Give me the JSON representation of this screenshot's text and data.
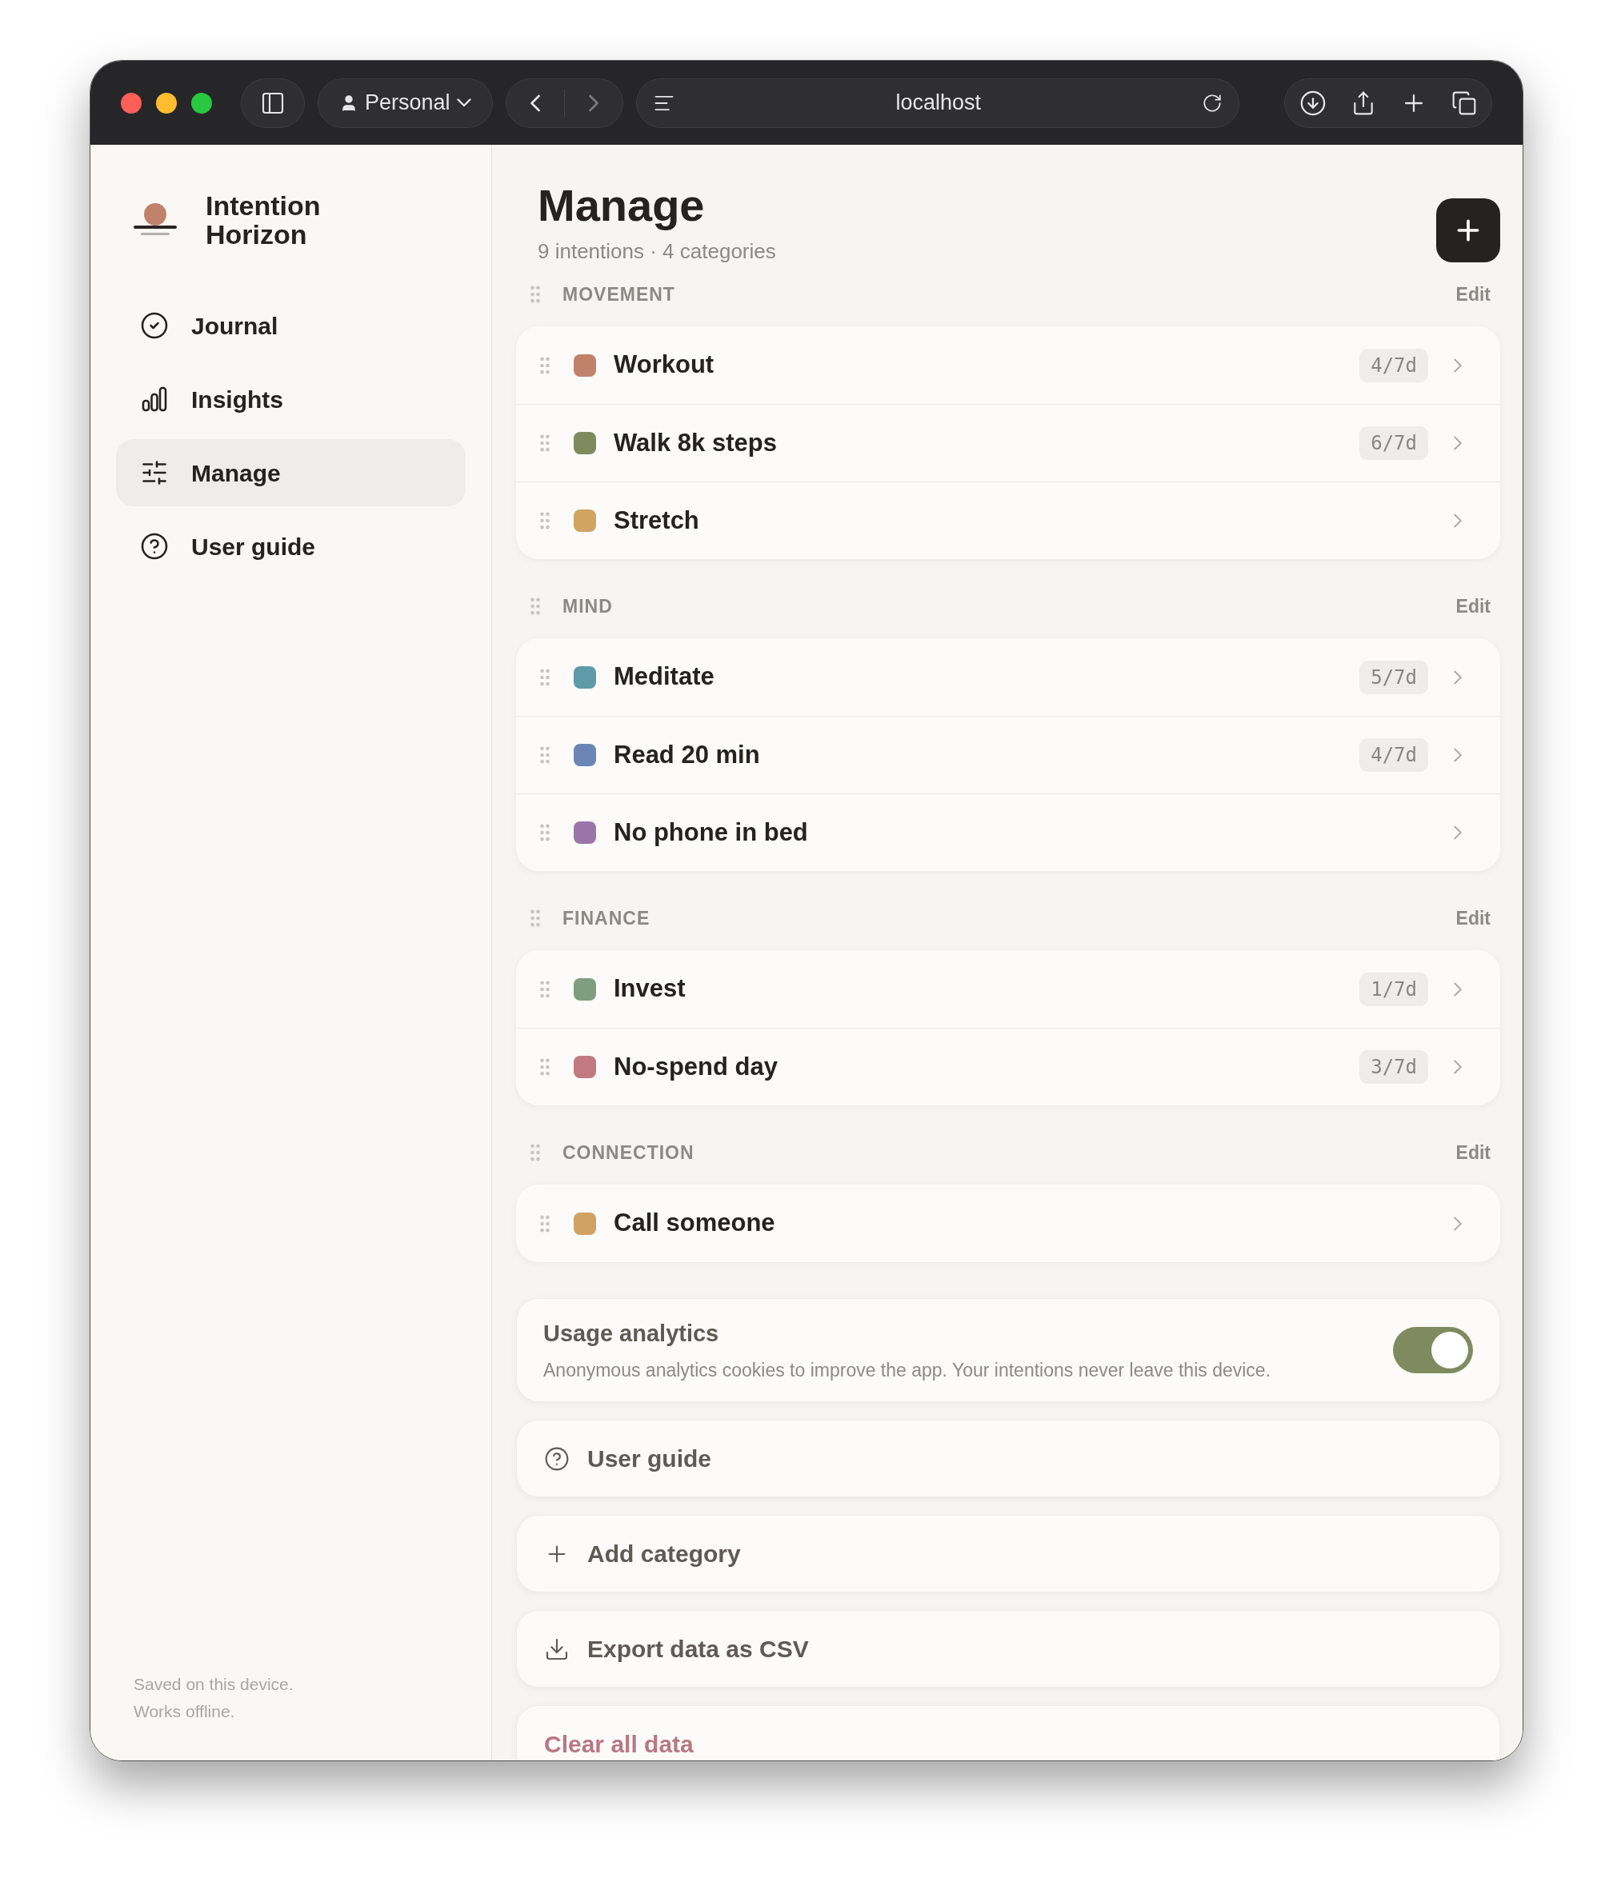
{
  "browser": {
    "profile": "Personal",
    "address": "localhost"
  },
  "sidebar": {
    "brand": [
      "Intention",
      "Horizon"
    ],
    "items": [
      {
        "label": "Journal",
        "selected": false
      },
      {
        "label": "Insights",
        "selected": false
      },
      {
        "label": "Manage",
        "selected": true
      },
      {
        "label": "User guide",
        "selected": false
      }
    ],
    "footer": [
      "Saved on this device.",
      "Works offline."
    ]
  },
  "header": {
    "title": "Manage",
    "subtitle": "9 intentions · 4 categories"
  },
  "categories": [
    {
      "name": "MOVEMENT",
      "edit": "Edit",
      "intentions": [
        {
          "name": "Workout",
          "color": "#c0826a",
          "badge": "4/7d"
        },
        {
          "name": "Walk 8k steps",
          "color": "#7f8b5f",
          "badge": "6/7d"
        },
        {
          "name": "Stretch",
          "color": "#d0a463"
        }
      ]
    },
    {
      "name": "MIND",
      "edit": "Edit",
      "intentions": [
        {
          "name": "Meditate",
          "color": "#5f9aa8",
          "badge": "5/7d"
        },
        {
          "name": "Read 20 min",
          "color": "#6b86b5",
          "badge": "4/7d"
        },
        {
          "name": "No phone in bed",
          "color": "#9a76a8"
        }
      ]
    },
    {
      "name": "FINANCE",
      "edit": "Edit",
      "intentions": [
        {
          "name": "Invest",
          "color": "#7f9e80",
          "badge": "1/7d"
        },
        {
          "name": "No-spend day",
          "color": "#c27a82",
          "badge": "3/7d"
        }
      ]
    },
    {
      "name": "CONNECTION",
      "edit": "Edit",
      "intentions": [
        {
          "name": "Call someone",
          "color": "#cfa264"
        }
      ]
    }
  ],
  "analytics": {
    "title": "Usage analytics",
    "description": "Anonymous analytics cookies to improve the app. Your intentions never leave this device.",
    "on": true
  },
  "actions": [
    {
      "kind": "guide",
      "label": "User guide"
    },
    {
      "kind": "add",
      "label": "Add category"
    },
    {
      "kind": "export",
      "label": "Export data as CSV"
    },
    {
      "kind": "danger",
      "label": "Clear all data"
    }
  ]
}
